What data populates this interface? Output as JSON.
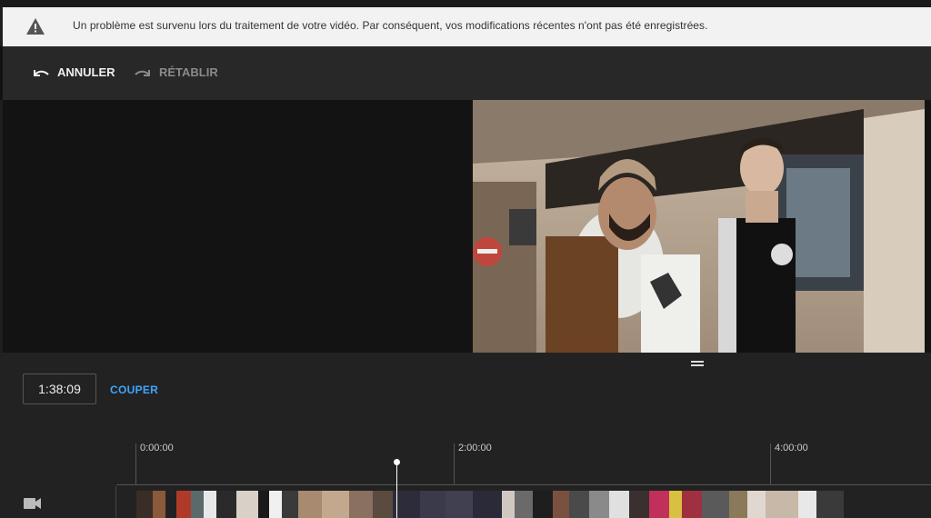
{
  "banner": {
    "icon": "warning-icon",
    "message": "Un problème est survenu lors du traitement de votre vidéo. Par conséquent, vos modifications récentes n'ont pas été enregistrées."
  },
  "toolbar": {
    "undo_label": "ANNULER",
    "undo_icon": "undo-icon",
    "redo_label": "RÉTABLIR",
    "redo_icon": "redo-icon"
  },
  "editor": {
    "current_time": "1:38:09",
    "cut_label": "COUPER"
  },
  "timeline": {
    "markers": [
      "0:00:00",
      "2:00:00",
      "4:00:00"
    ],
    "track_icon": "video-camera-icon"
  },
  "colors": {
    "accent": "#3ea6ff",
    "banner_bg": "#f2f2f2",
    "background": "#1f1f1f"
  }
}
